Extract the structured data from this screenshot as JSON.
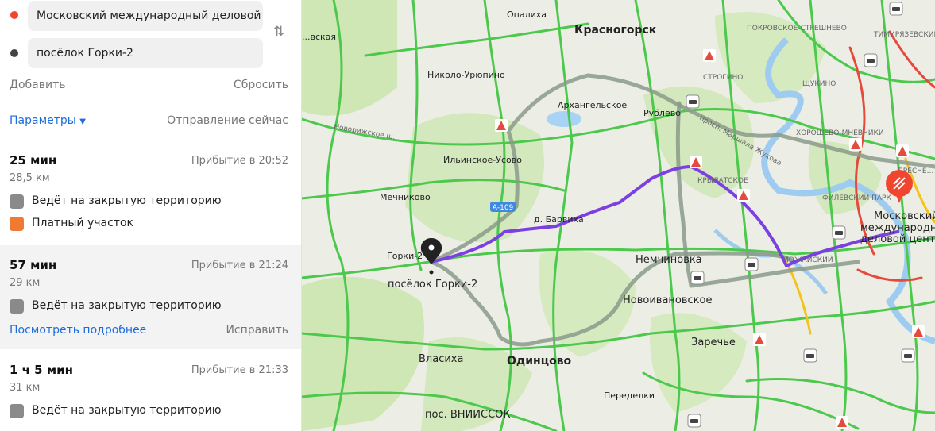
{
  "route_form": {
    "from_value": "Московский международный деловой ...",
    "to_value": "посёлок Горки-2",
    "add_label": "Добавить",
    "reset_label": "Сбросить",
    "params_label": "Параметры",
    "depart_label": "Отправление сейчас"
  },
  "routes": [
    {
      "time": "25 мин",
      "arrival": "Прибытие в 20:52",
      "distance": "28,5 км",
      "notes": [
        "Ведёт на закрытую территорию",
        "Платный участок"
      ]
    },
    {
      "time": "57 мин",
      "arrival": "Прибытие в 21:24",
      "distance": "29 км",
      "notes": [
        "Ведёт на закрытую территорию"
      ],
      "details_label": "Посмотреть подробнее",
      "fix_label": "Исправить"
    },
    {
      "time": "1 ч 5 мин",
      "arrival": "Прибытие в 21:33",
      "distance": "31 км",
      "notes": [
        "Ведёт на закрытую территорию"
      ]
    }
  ],
  "map": {
    "places": {
      "opalikha": "Опалиха",
      "krasnogorsk": "Красногорск",
      "nikolo_uryupino": "Николо-Урюпино",
      "arkhangelskoe": "Архангельское",
      "rublevo": "Рублёво",
      "strogino": "СТРОГИНО",
      "shchukino": "ЩУКИНО",
      "pokrovskoe_streshnevo": "ПОКРОВСКОЕ-СТРЕШНЕВО",
      "timiryazevsky": "ТИМИРЯЗЕВСКИЙ",
      "khoroshevo_mnevniki": "ХОРОШЁВО-МНЁВНИКИ",
      "presnensky": "ПРЕСНЕ...",
      "krylatskoe": "КРЫЛАТСКОЕ",
      "filevsky_park": "ФИЛЁВСКИЙ ПАРК",
      "mozhaysky": "МОЖАЙСКИЙ",
      "ilinskoe_usovo": "Ильинское-Усово",
      "mechnikovo": "Мечниково",
      "barvikha": "д. Барвиха",
      "gorki2_short": "Горки-2",
      "gorki2": "посёлок Горки-2",
      "nemchinovka": "Немчиновка",
      "novoivanovskoe": "Новоивановское",
      "zarechye": "Заречье",
      "vlasikha": "Власиха",
      "odintsovo": "Одинцово",
      "peredelki": "Переделки",
      "vniissok": "пос. ВНИИССОК",
      "moskovskaya": "...вская",
      "mkdc_line1": "Московский",
      "mkdc_line2": "международн...",
      "mkdc_line3": "деловой цент..."
    },
    "roads": {
      "novorizhskoe": "Новорижское ш.",
      "marshala_zhukova": "просп. Маршала Жукова",
      "a109": "А-109"
    },
    "colors": {
      "route_main": "#7b3fe4",
      "route_alt": "#8a9a8a",
      "traffic_green": "#4cc94c",
      "traffic_red": "#e54b3c",
      "traffic_yellow": "#f3c21c",
      "destination_marker": "#f2452f",
      "start_marker": "#222222",
      "highway_badge": "#3f8ae0"
    },
    "icons": {
      "start_marker": "map-pin-icon",
      "destination_marker": "destination-pin-icon",
      "roadwork": "roadwork-sign-icon",
      "incident": "incident-car-icon"
    }
  }
}
